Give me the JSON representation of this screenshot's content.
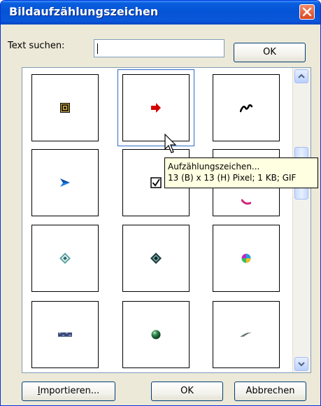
{
  "window": {
    "title": "Bildaufzählungszeichen",
    "close_icon": "close-icon"
  },
  "search": {
    "label": "Text suchen:",
    "value": ""
  },
  "buttons": {
    "search_ok": "OK",
    "import_prefix": "I",
    "import_rest": "mportieren...",
    "ok": "OK",
    "cancel": "Abbrechen"
  },
  "tooltip": {
    "line1": "Aufzählungszeichen...",
    "line2": "13 (B) x 13 (H) Pixel; 1 KB; GIF"
  },
  "gallery": {
    "items": [
      {
        "icon": "square-spiral-bullet-icon"
      },
      {
        "icon": "red-arrow-bullet-icon"
      },
      {
        "icon": "black-swirl-bullet-icon"
      },
      {
        "icon": "blue-arrowhead-bullet-icon"
      },
      {
        "icon": "checkbox-bullet-icon"
      },
      {
        "icon": "pink-swoosh-bullet-icon"
      },
      {
        "icon": "teal-diamond-bullet-icon"
      },
      {
        "icon": "dark-diamond-bullet-icon"
      },
      {
        "icon": "rainbow-ball-bullet-icon"
      },
      {
        "icon": "textured-bar-bullet-icon"
      },
      {
        "icon": "green-sphere-bullet-icon"
      },
      {
        "icon": "feather-bullet-icon"
      }
    ]
  },
  "colors": {
    "titlebar": "#0553d6",
    "dialog_bg": "#ece9d8",
    "tooltip_bg": "#ffffe1",
    "selection": "#316ac5"
  }
}
